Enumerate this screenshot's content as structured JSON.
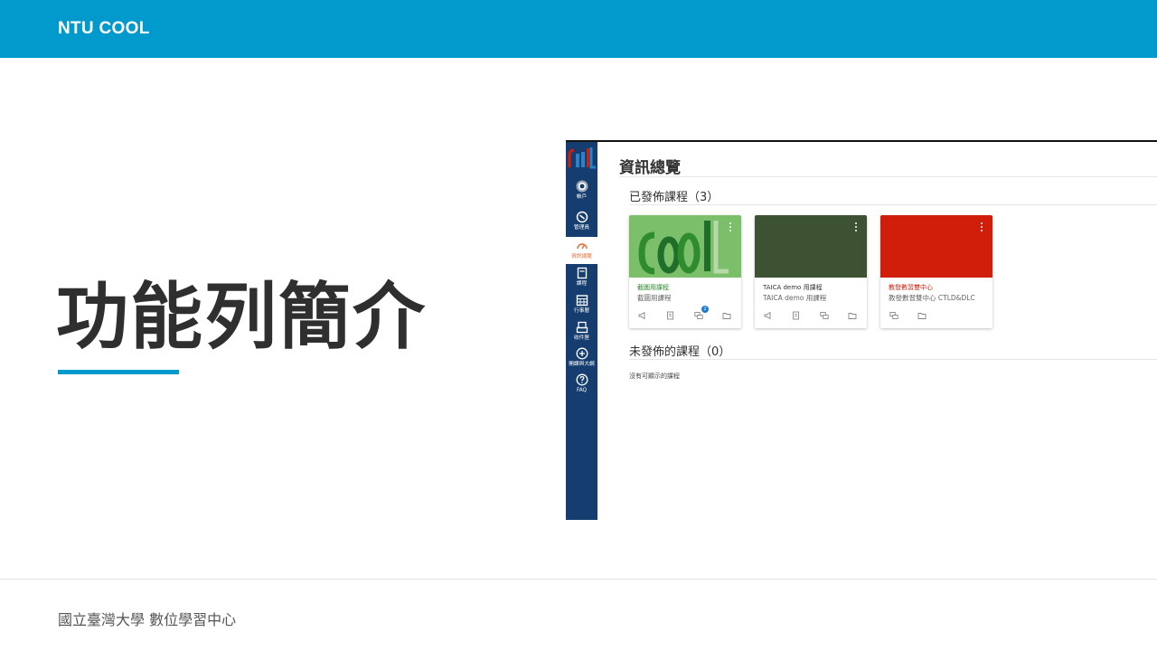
{
  "header": {
    "brand": "NTU COOL"
  },
  "slide": {
    "title": "功能列簡介"
  },
  "footer": {
    "org": "國立臺灣大學 數位學習中心"
  },
  "colors": {
    "accent": "#0299cc",
    "nav_bg": "#163d6f",
    "active": "#e26a2c"
  },
  "app": {
    "nav": [
      {
        "label": "帳戶",
        "icon": "account-icon",
        "active": false
      },
      {
        "label": "管理員",
        "icon": "shield-icon",
        "active": false
      },
      {
        "label": "資訊總覽",
        "icon": "dashboard-icon",
        "active": true
      },
      {
        "label": "課程",
        "icon": "book-icon",
        "active": false
      },
      {
        "label": "行事曆",
        "icon": "calendar-icon",
        "active": false
      },
      {
        "label": "收件匣",
        "icon": "inbox-icon",
        "active": false
      },
      {
        "label": "開課與大綱",
        "icon": "plus-circle-icon",
        "active": false
      },
      {
        "label": "FAQ",
        "icon": "help-icon",
        "active": false
      }
    ],
    "page_title": "資訊總覽",
    "published_heading": "已發佈課程（3）",
    "unpublished_heading": "未發佈的課程（0）",
    "empty_message": "沒有可顯示的課程",
    "cards": [
      {
        "name": "截圖用課程",
        "code": "截圖用課程",
        "hero_color": "#7bbf6a",
        "name_color": "#2e8b2e",
        "badge": "2",
        "icons": [
          "announcement-icon",
          "assignment-icon",
          "discussion-icon",
          "folder-icon"
        ]
      },
      {
        "name": "TAICA demo 用課程",
        "code": "TAICA demo 用課程",
        "hero_color": "#3c5233",
        "name_color": "#333333",
        "badge": null,
        "icons": [
          "announcement-icon",
          "assignment-icon",
          "discussion-icon",
          "folder-icon"
        ]
      },
      {
        "name": "教發數習雙中心",
        "code": "教發數習雙中心 CTLD&DLC",
        "hero_color": "#d11e0b",
        "name_color": "#d11e0b",
        "badge": null,
        "icons": [
          "discussion-icon",
          "folder-icon"
        ]
      }
    ]
  }
}
